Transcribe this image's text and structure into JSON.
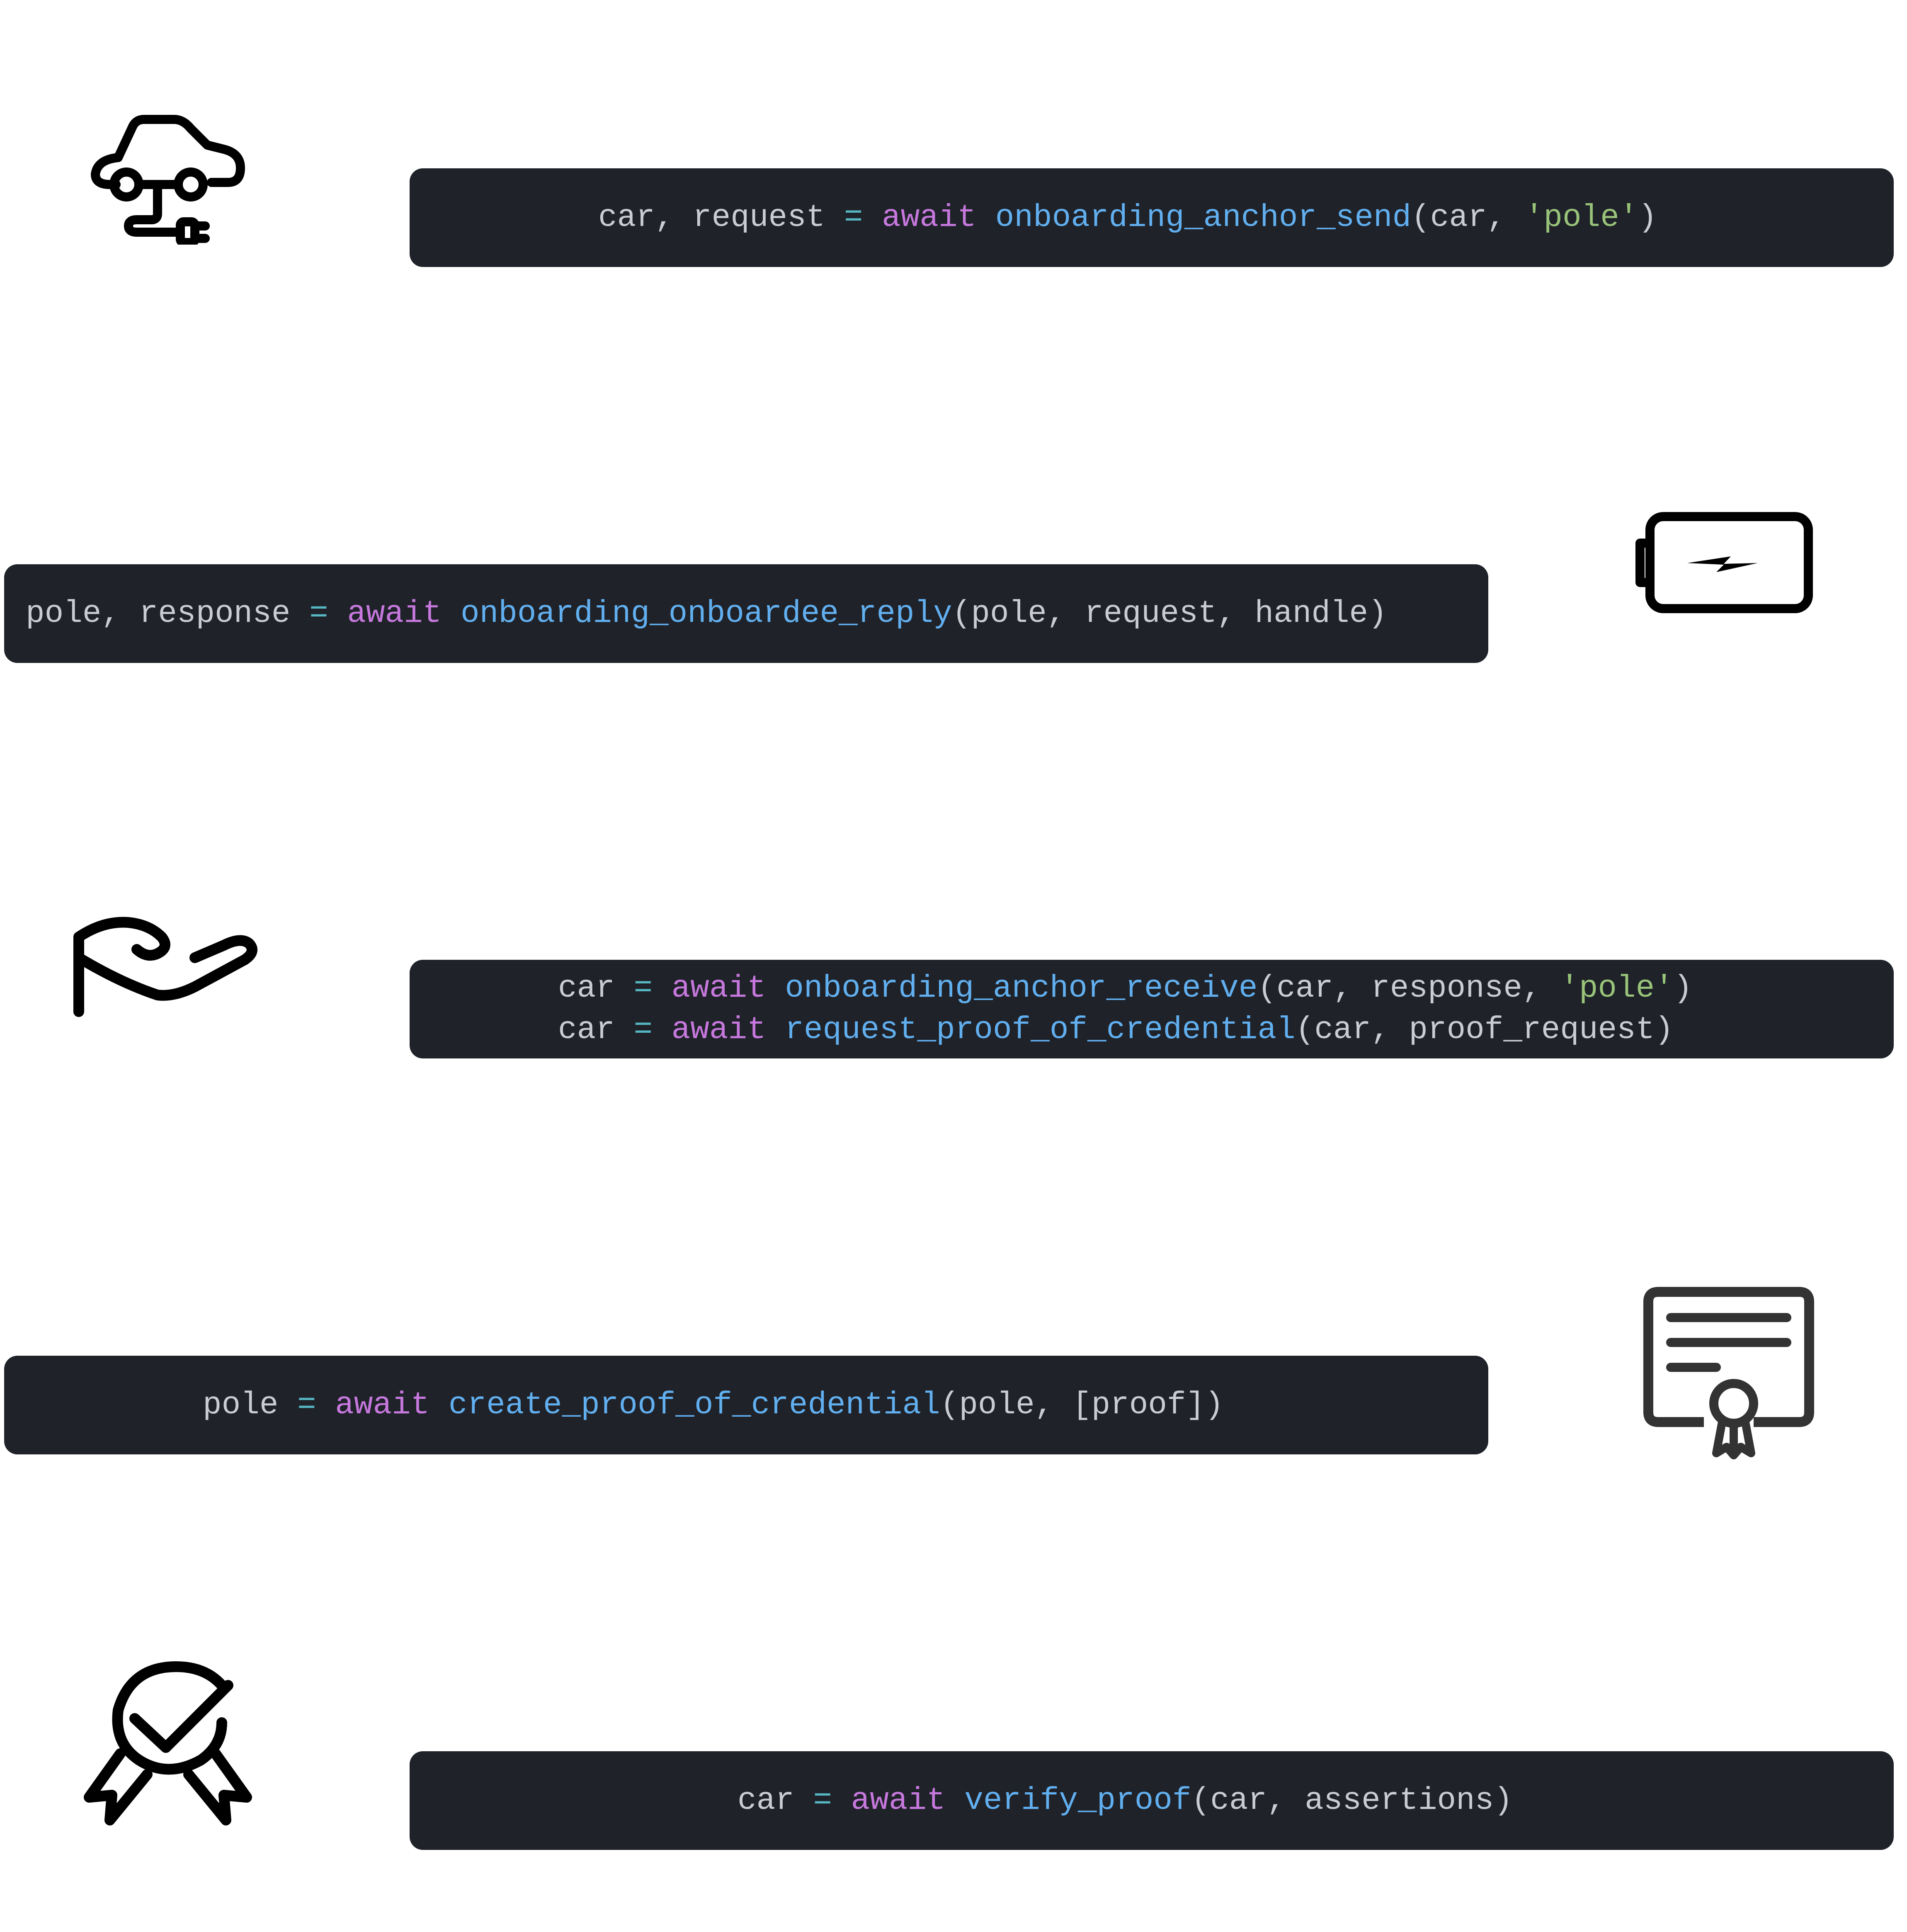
{
  "steps": [
    {
      "icon": "electric-car-plug-icon",
      "lines": [
        [
          {
            "t": "car, request ",
            "c": "plain"
          },
          {
            "t": "=",
            "c": "op"
          },
          {
            "t": " ",
            "c": "plain"
          },
          {
            "t": "await",
            "c": "kw"
          },
          {
            "t": " ",
            "c": "plain"
          },
          {
            "t": "onboarding_anchor_send",
            "c": "fn"
          },
          {
            "t": "(car, ",
            "c": "plain"
          },
          {
            "t": "'pole'",
            "c": "str"
          },
          {
            "t": ")",
            "c": "plain"
          }
        ]
      ]
    },
    {
      "icon": "battery-charging-icon",
      "lines": [
        [
          {
            "t": "pole, response ",
            "c": "plain"
          },
          {
            "t": "=",
            "c": "op"
          },
          {
            "t": " ",
            "c": "plain"
          },
          {
            "t": "await",
            "c": "kw"
          },
          {
            "t": " ",
            "c": "plain"
          },
          {
            "t": "onboarding_onboardee_reply",
            "c": "fn"
          },
          {
            "t": "(pole, request, handle)",
            "c": "plain"
          }
        ]
      ]
    },
    {
      "icon": "open-hand-icon",
      "lines": [
        [
          {
            "t": "car ",
            "c": "plain"
          },
          {
            "t": "=",
            "c": "op"
          },
          {
            "t": " ",
            "c": "plain"
          },
          {
            "t": "await",
            "c": "kw"
          },
          {
            "t": " ",
            "c": "plain"
          },
          {
            "t": "onboarding_anchor_receive",
            "c": "fn"
          },
          {
            "t": "(car, response, ",
            "c": "plain"
          },
          {
            "t": "'pole'",
            "c": "str"
          },
          {
            "t": ")",
            "c": "plain"
          }
        ],
        [
          {
            "t": "car ",
            "c": "plain"
          },
          {
            "t": "=",
            "c": "op"
          },
          {
            "t": " ",
            "c": "plain"
          },
          {
            "t": "await",
            "c": "kw"
          },
          {
            "t": " ",
            "c": "plain"
          },
          {
            "t": "request_proof_of_credential",
            "c": "fn"
          },
          {
            "t": "(car, proof_request)",
            "c": "plain"
          }
        ]
      ]
    },
    {
      "icon": "certificate-icon",
      "lines": [
        [
          {
            "t": "pole ",
            "c": "plain"
          },
          {
            "t": "=",
            "c": "op"
          },
          {
            "t": " ",
            "c": "plain"
          },
          {
            "t": "await",
            "c": "kw"
          },
          {
            "t": " ",
            "c": "plain"
          },
          {
            "t": "create_proof_of_credential",
            "c": "fn"
          },
          {
            "t": "(pole, [proof])",
            "c": "plain"
          }
        ]
      ]
    },
    {
      "icon": "verified-badge-icon",
      "lines": [
        [
          {
            "t": "car ",
            "c": "plain"
          },
          {
            "t": "=",
            "c": "op"
          },
          {
            "t": " ",
            "c": "plain"
          },
          {
            "t": "await",
            "c": "kw"
          },
          {
            "t": " ",
            "c": "plain"
          },
          {
            "t": "verify_proof",
            "c": "fn"
          },
          {
            "t": "(car, assertions)",
            "c": "plain"
          }
        ]
      ]
    }
  ],
  "colors": {
    "block_bg": "#1f2229",
    "plain": "#c9cdd3",
    "operator": "#56b6c2",
    "keyword": "#c678dd",
    "function": "#61afef",
    "string": "#98c379"
  }
}
